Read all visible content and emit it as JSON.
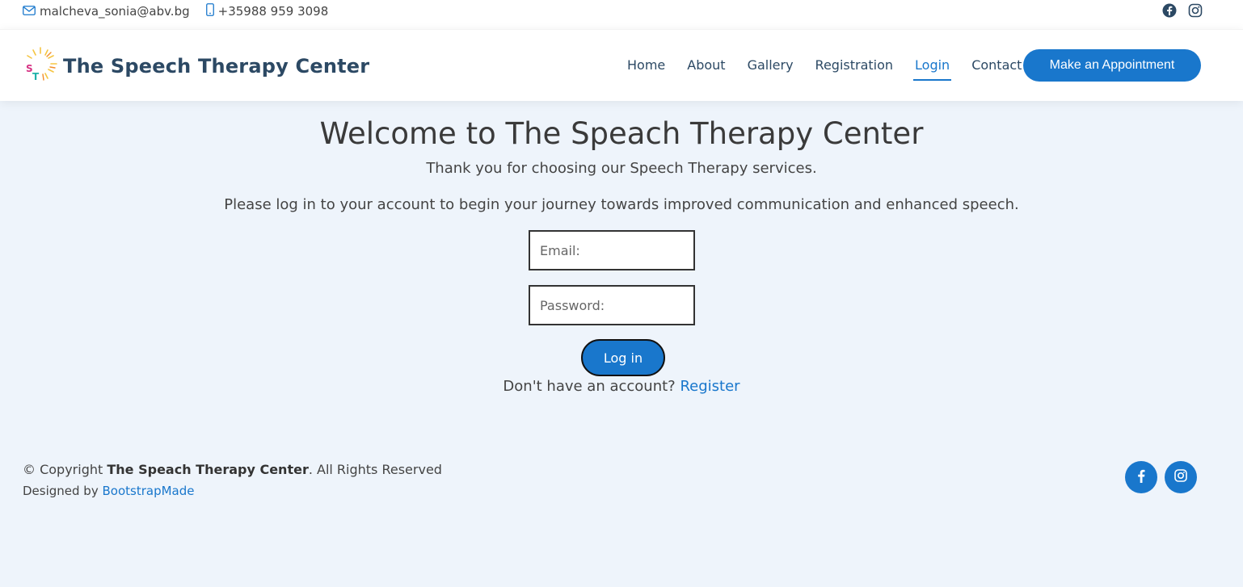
{
  "topbar": {
    "email": "malcheva_sonia@abv.bg",
    "phone": "+35988 959 3098"
  },
  "header": {
    "brand": "The Speech Therapy Center",
    "logo_letters": "ST",
    "nav": [
      "Home",
      "About",
      "Gallery",
      "Registration",
      "Login",
      "Contact"
    ],
    "active_nav": "Login",
    "appointment_button": "Make an Appointment"
  },
  "main": {
    "title": "Welcome to The Speach Therapy Center",
    "subtitle": "Thank you for choosing our Speech Therapy services.",
    "prompt": "Please log in to your account to begin your journey towards improved communication and enhanced speech.",
    "email_placeholder": "Email:",
    "password_placeholder": "Password:",
    "login_button": "Log in",
    "no_account_text": "Don't have an account?",
    "register_link": "Register"
  },
  "footer": {
    "copyright_prefix": "© Copyright",
    "copyright_name": "The Speach Therapy Center",
    "copyright_suffix": ". All Rights Reserved",
    "designed_by_prefix": "Designed by",
    "designed_by_link": "BootstrapMade"
  },
  "icons": [
    "envelope-icon",
    "phone-icon",
    "facebook-icon",
    "instagram-icon"
  ],
  "colors": {
    "accent": "#1977cc",
    "heading": "#2c4964",
    "background": "#eef4fb"
  }
}
